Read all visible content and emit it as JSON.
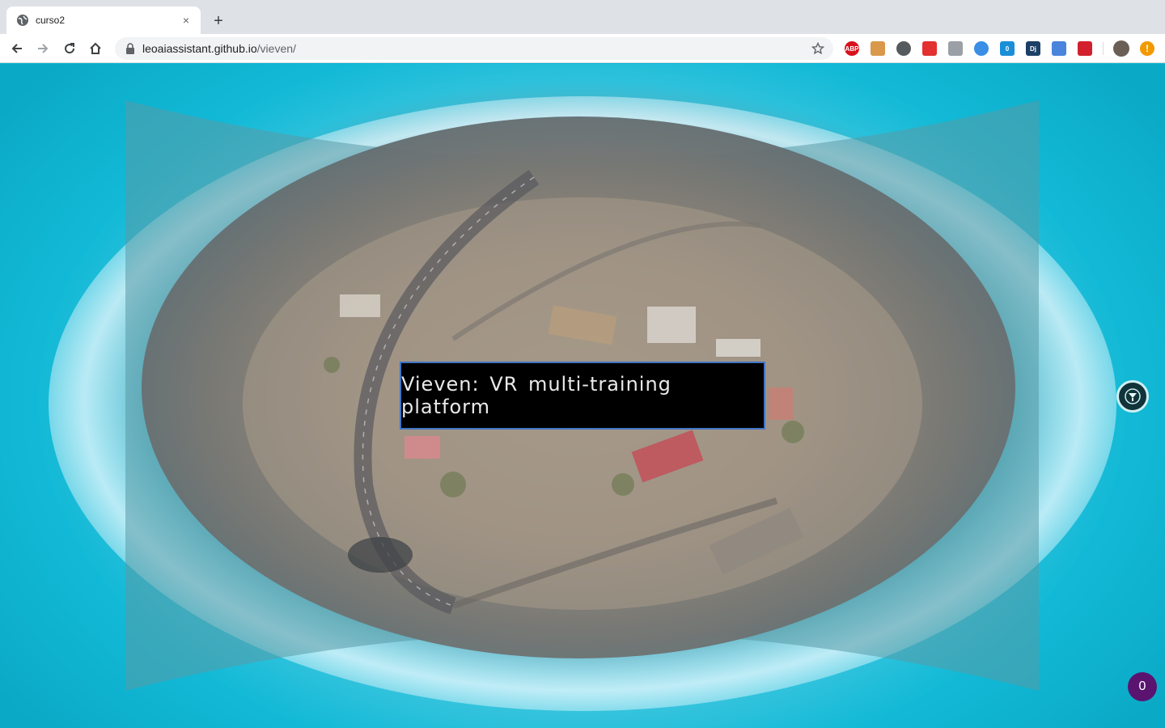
{
  "browser": {
    "tab": {
      "title": "curso2"
    },
    "new_tab_label": "+",
    "close_label": "×",
    "address": {
      "domain": "leoaiassistant.github.io",
      "path": "/vieven/"
    },
    "extensions": [
      {
        "name": "adblock-plus-icon",
        "label": "ABP",
        "color": "#d7121d"
      },
      {
        "name": "cookie-icon",
        "label": "",
        "color": "#d9984a"
      },
      {
        "name": "circle-ext-icon",
        "label": "",
        "color": "#555a5e"
      },
      {
        "name": "red-arrow-ext-icon",
        "label": "",
        "color": "#e2312f"
      },
      {
        "name": "brush-ext-icon",
        "label": "",
        "color": "#9aa0a6"
      },
      {
        "name": "pulse-ext-icon",
        "label": "",
        "color": "#3a8ee6"
      },
      {
        "name": "shield-ext-icon",
        "label": "0",
        "color": "#1a8fd8"
      },
      {
        "name": "dj-ext-icon",
        "label": "Dj",
        "color": "#1c3f66"
      },
      {
        "name": "outline-ext-icon",
        "label": "",
        "color": "#4a84dc"
      },
      {
        "name": "red-play-ext-icon",
        "label": "",
        "color": "#d3202e"
      }
    ],
    "alert_color": "#f29900"
  },
  "page": {
    "headline": "Vieven: VR multi-training platform",
    "counter": "0"
  }
}
